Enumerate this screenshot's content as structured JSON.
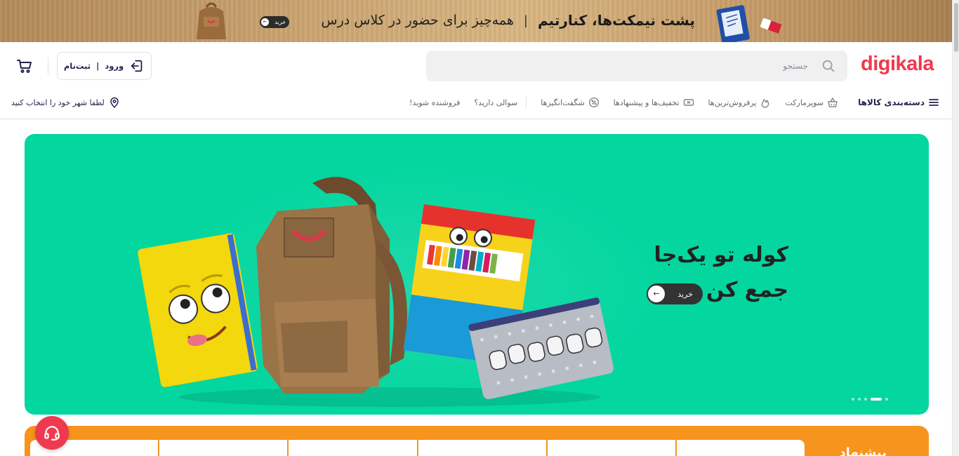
{
  "promo_strip": {
    "title": "پشت نیمکت‌ها، کنارتیم",
    "separator": "|",
    "subtitle": "همه‌چیز برای حضور در کلاس درس",
    "buy_label": "خرید"
  },
  "header": {
    "logo": "digikala",
    "search": {
      "placeholder": "جستجو"
    },
    "login": {
      "login_label": "ورود",
      "separator": "|",
      "signup_label": "ثبت‌نام"
    }
  },
  "nav": {
    "items": [
      {
        "label": "دسته‌بندی کالاها",
        "icon": "menu-icon"
      },
      {
        "label": "سوپرمارکت",
        "icon": "basket-icon"
      },
      {
        "label": "پرفروش‌ترین‌ها",
        "icon": "fire-icon"
      },
      {
        "label": "تخفیف‌ها و پیشنهادها",
        "icon": "coupon-icon"
      },
      {
        "label": "شگفت‌انگیزها",
        "icon": "percent-icon"
      },
      {
        "label": "سوالی دارید؟"
      },
      {
        "label": "فروشنده شوید!"
      }
    ],
    "city_label": "لطفا شهر خود را انتخاب کنید"
  },
  "hero": {
    "title_line1": "کوله تو یک‌جا",
    "title_line2": "جمع کن",
    "buy_label": "خرید",
    "slide_count": 5,
    "active_slide": 2
  },
  "offer": {
    "title": "پیشنهاد"
  },
  "colors": {
    "brand": "#ef394e",
    "hero_bg": "#04d6a0",
    "offer_bg": "#f7941d"
  }
}
